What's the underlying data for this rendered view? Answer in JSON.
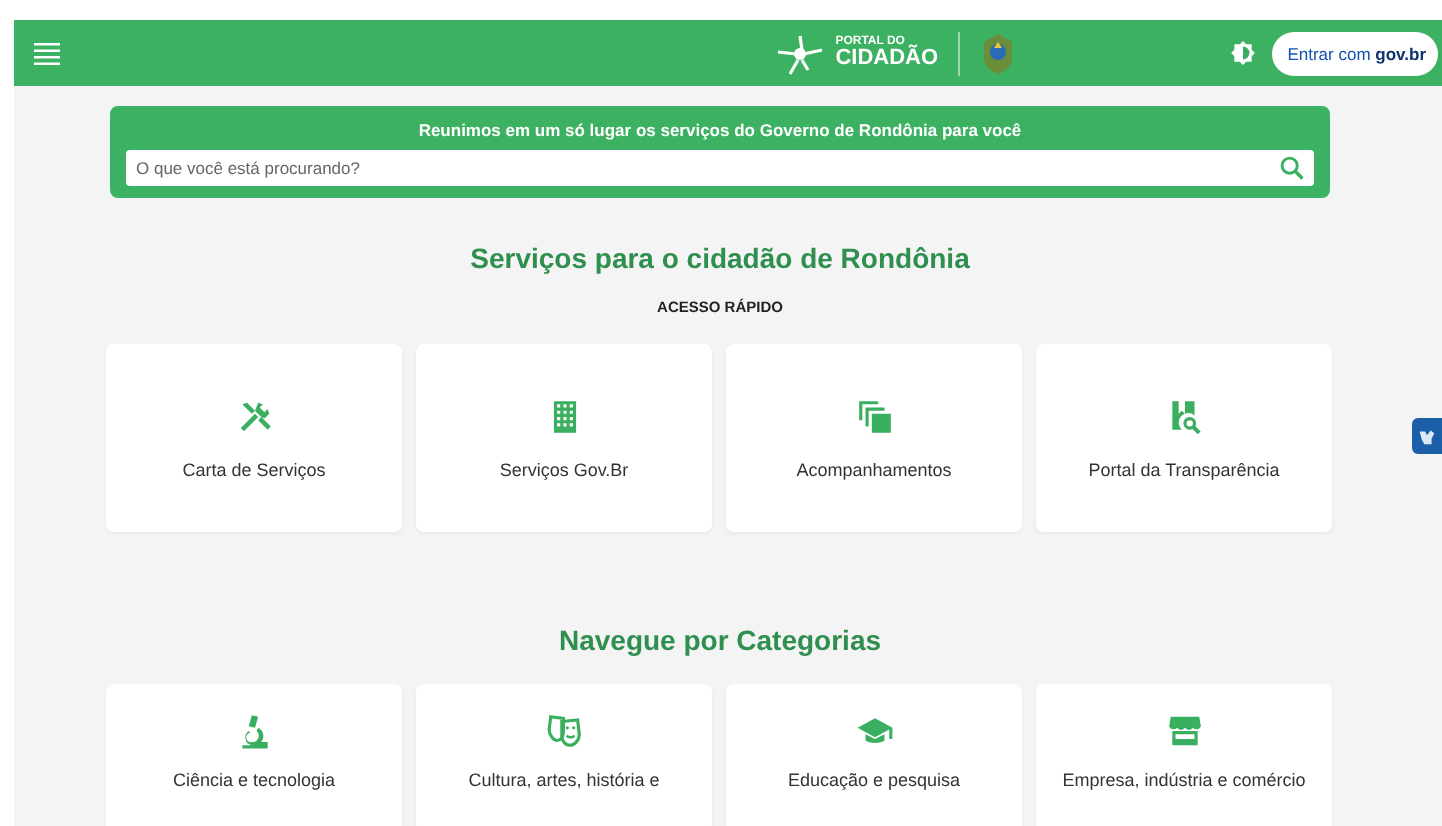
{
  "header": {
    "logo_small": "PORTAL DO",
    "logo_large": "CIDADÃO",
    "login_prefix": "Entrar com ",
    "login_brand": "gov.br"
  },
  "banner": {
    "title": "Reunimos em um só lugar os serviços do Governo de Rondônia para você",
    "search": {
      "placeholder": "O que você está procurando?"
    }
  },
  "services": {
    "title": "Serviços para o cidadão de Rondônia",
    "subtitle": "ACESSO RÁPIDO",
    "cards": [
      {
        "kind": "tools",
        "label": "Carta de Serviços"
      },
      {
        "kind": "building",
        "label": "Serviços Gov.Br"
      },
      {
        "kind": "copies",
        "label": "Acompanhamentos"
      },
      {
        "kind": "document-search",
        "label": "Portal da Transparência"
      }
    ]
  },
  "categories": {
    "title": "Navegue por Categorias",
    "cards": [
      {
        "kind": "microscope",
        "label": "Ciência e tecnologia"
      },
      {
        "kind": "masks",
        "label": "Cultura, artes, história e"
      },
      {
        "kind": "graduation",
        "label": "Educação e pesquisa"
      },
      {
        "kind": "store",
        "label": "Empresa, indústria e comércio"
      }
    ]
  }
}
